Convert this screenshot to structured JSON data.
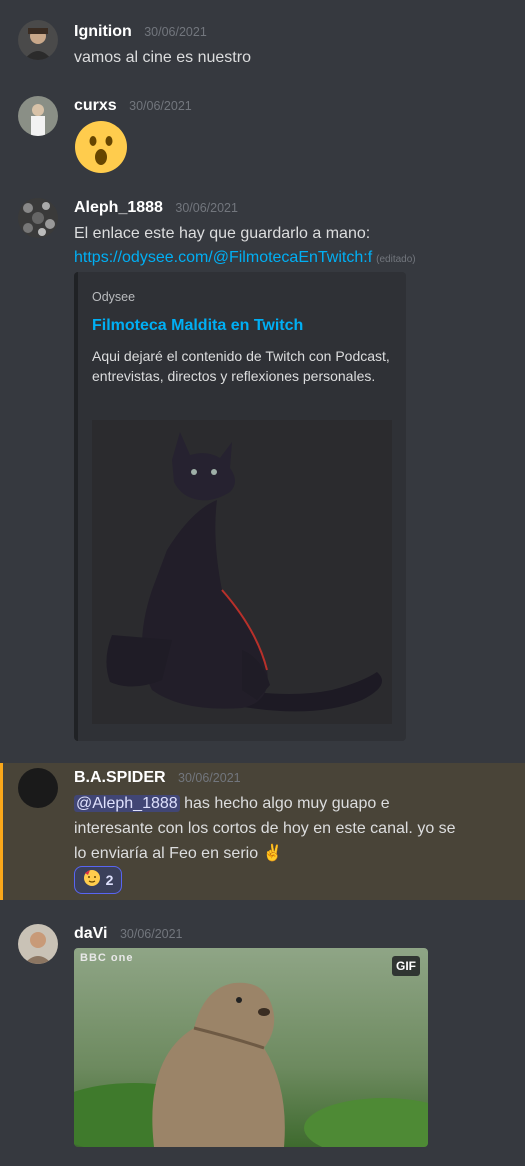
{
  "messages": [
    {
      "username": "Ignition",
      "timestamp": "30/06/2021",
      "text": "vamos al cine es nuestro"
    },
    {
      "username": "curxs",
      "timestamp": "30/06/2021",
      "emoji": "hushed-face"
    },
    {
      "username": "Aleph_1888",
      "timestamp": "30/06/2021",
      "text": "El enlace este hay que guardarlo a mano:",
      "link": "https://odysee.com/@FilmotecaEnTwitch:f",
      "edited": "(editado)",
      "embed": {
        "provider": "Odysee",
        "title": "Filmoteca Maldita en Twitch",
        "description": "Aqui dejaré el contenido de Twitch con Podcast, entrevistas, directos y reflexiones personales.",
        "image": "black-cat-illustration"
      }
    },
    {
      "username": "B.A.SPIDER",
      "timestamp": "30/06/2021",
      "mention": "@Aleph_1888",
      "text_line1": " has hecho algo muy guapo e",
      "text_line2": "interesante con los cortos de hoy en este canal. yo se",
      "text_line3": "lo enviaría al Feo en serio",
      "text_emoji": "✌️",
      "reaction": {
        "emoji": "partying-face",
        "count": "2"
      }
    },
    {
      "username": "daVi",
      "timestamp": "30/06/2021",
      "gif": {
        "badge": "GIF",
        "watermark": "BBC one",
        "image": "marmot"
      }
    }
  ],
  "colors": {
    "background": "#36393f",
    "link": "#00aff4",
    "mention_highlight": "#494438",
    "mention_bar": "#faa81a"
  }
}
